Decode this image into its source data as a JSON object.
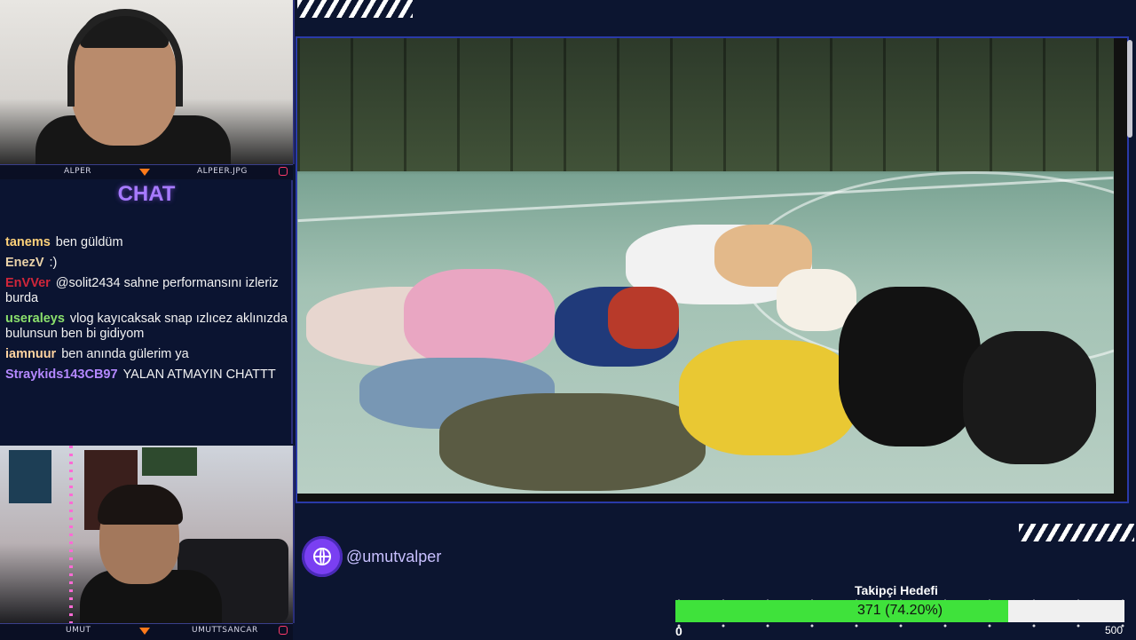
{
  "webcams": {
    "top": {
      "left_label": "ALPER",
      "right_label": "ALPEER.JPG"
    },
    "bottom": {
      "left_label": "UMUT",
      "right_label": "UMUTTSANCAR"
    }
  },
  "chat": {
    "title": "CHAT",
    "messages": [
      {
        "user": "tanems",
        "color": "#ffd27a",
        "text": "ben güldüm"
      },
      {
        "user": "EnezV",
        "color": "#e9d2a8",
        "text": ":)"
      },
      {
        "user": "EnVVer",
        "color": "#d0263a",
        "text": "@solit2434 sahne performansını izleriz burda"
      },
      {
        "user": "useraleys",
        "color": "#8be06c",
        "text": "vlog kayıcaksak snap ızlıcez aklınızda bulunsun ben bi gidiyom"
      },
      {
        "user": "iamnuur",
        "color": "#ffd3a0",
        "text": "ben anında gülerim ya"
      },
      {
        "user": "Straykids143CB97",
        "color": "#b488ff",
        "text": "YALAN ATMAYIN CHATTT"
      }
    ]
  },
  "social": {
    "handle": "@umutvalper",
    "icon": "globe-icon"
  },
  "follower_goal": {
    "title": "Takipçi Hedefi",
    "progress_text": "371 (74.20%)",
    "current": 371,
    "target": 500,
    "fraction": 0.742,
    "min_label": "0",
    "max_label": "500"
  },
  "colors": {
    "accent": "#a77aff",
    "frame": "#2a3aa8",
    "progress": "#3fe23b",
    "background": "#0c1530"
  }
}
